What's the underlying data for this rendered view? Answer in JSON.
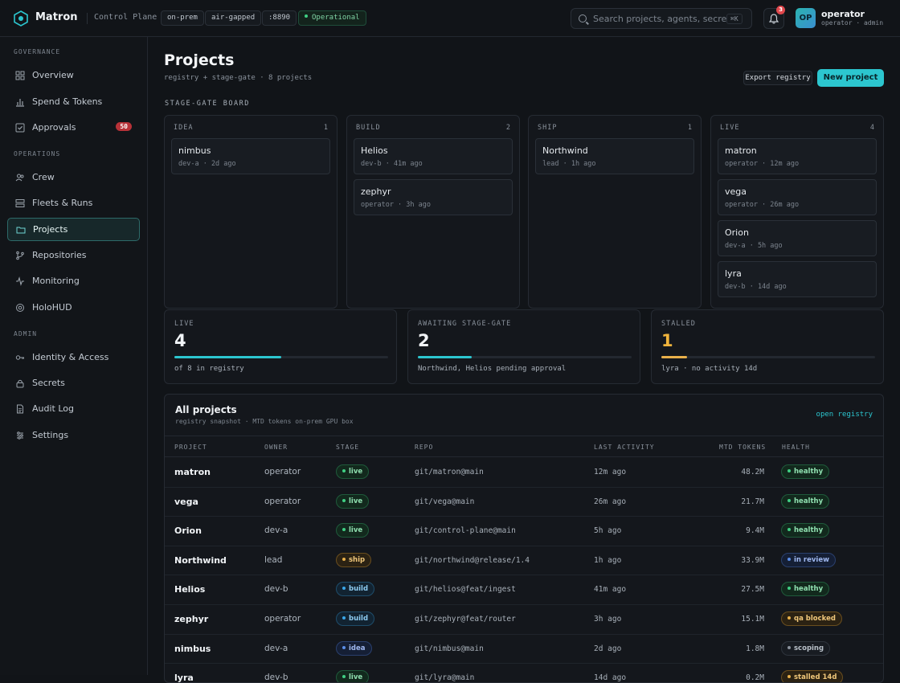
{
  "app": {
    "title": "Matron",
    "subtitle": "Control Plane"
  },
  "env_pills": [
    "on-prem",
    "air-gapped",
    ":8890"
  ],
  "status_pill": "Operational",
  "search": {
    "placeholder": "Search projects, agents, secrets...",
    "shortcut": "⌘K"
  },
  "notifications": {
    "count": "3"
  },
  "user": {
    "initials": "OP",
    "name": "operator",
    "role": "operator · admin"
  },
  "sidebar": {
    "sections": [
      {
        "label": "GOVERNANCE",
        "items": [
          {
            "label": "Overview",
            "icon": "grid-icon"
          },
          {
            "label": "Spend & Tokens",
            "icon": "bar-chart-icon"
          },
          {
            "label": "Approvals",
            "icon": "check-square-icon",
            "badge": "50"
          }
        ]
      },
      {
        "label": "OPERATIONS",
        "items": [
          {
            "label": "Crew",
            "icon": "users-icon"
          },
          {
            "label": "Fleets & Runs",
            "icon": "server-icon"
          },
          {
            "label": "Projects",
            "icon": "folder-icon",
            "active": true
          },
          {
            "label": "Repositories",
            "icon": "git-branch-icon"
          },
          {
            "label": "Monitoring",
            "icon": "activity-icon"
          },
          {
            "label": "HoloHUD",
            "icon": "target-icon"
          }
        ]
      },
      {
        "label": "ADMIN",
        "items": [
          {
            "label": "Identity & Access",
            "icon": "key-icon"
          },
          {
            "label": "Secrets",
            "icon": "lock-icon"
          },
          {
            "label": "Audit Log",
            "icon": "file-text-icon"
          },
          {
            "label": "Settings",
            "icon": "sliders-icon"
          }
        ]
      }
    ]
  },
  "page": {
    "title": "Projects",
    "subtitle": "registry + stage-gate · 8 projects",
    "export_label": "Export registry",
    "new_label": "New project",
    "board_label": "STAGE-GATE BOARD"
  },
  "board": [
    {
      "stage": "IDEA",
      "count": "1",
      "cards": [
        {
          "name": "nimbus",
          "meta": "dev-a · 2d ago"
        }
      ]
    },
    {
      "stage": "BUILD",
      "count": "2",
      "cards": [
        {
          "name": "Helios",
          "meta": "dev-b · 41m ago"
        },
        {
          "name": "zephyr",
          "meta": "operator · 3h ago"
        }
      ]
    },
    {
      "stage": "SHIP",
      "count": "1",
      "cards": [
        {
          "name": "Northwind",
          "meta": "lead · 1h ago"
        }
      ]
    },
    {
      "stage": "LIVE",
      "count": "4",
      "cards": [
        {
          "name": "matron",
          "meta": "operator · 12m ago"
        },
        {
          "name": "vega",
          "meta": "operator · 26m ago"
        },
        {
          "name": "Orion",
          "meta": "dev-a · 5h ago"
        },
        {
          "name": "lyra",
          "meta": "dev-b · 14d ago"
        }
      ]
    }
  ],
  "stats": [
    {
      "label": "LIVE",
      "value": "4",
      "note": "of 8 in registry",
      "progress": 0.5,
      "color": "#2cc6cf",
      "value_color": "#f1f4f7"
    },
    {
      "label": "AWAITING STAGE-GATE",
      "value": "2",
      "note": "Northwind, Helios pending approval",
      "progress": 0.25,
      "color": "#2cc6cf",
      "value_color": "#f1f4f7"
    },
    {
      "label": "STALLED",
      "value": "1",
      "note": "lyra · no activity 14d",
      "progress": 0.12,
      "color": "#e8b04a",
      "value_color": "#f0b43c"
    }
  ],
  "table": {
    "title": "All projects",
    "subtitle": "registry snapshot · MTD tokens on-prem GPU box",
    "link": "open registry",
    "columns": [
      "PROJECT",
      "OWNER",
      "STAGE",
      "REPO",
      "LAST ACTIVITY",
      "MTD TOKENS",
      "HEALTH"
    ],
    "rows": [
      {
        "project": "matron",
        "owner": "operator",
        "stage": "live",
        "repo": "git/matron@main",
        "activity": "12m ago",
        "tokens": "48.2M",
        "health": "healthy"
      },
      {
        "project": "vega",
        "owner": "operator",
        "stage": "live",
        "repo": "git/vega@main",
        "activity": "26m ago",
        "tokens": "21.7M",
        "health": "healthy"
      },
      {
        "project": "Orion",
        "owner": "dev-a",
        "stage": "live",
        "repo": "git/control-plane@main",
        "activity": "5h ago",
        "tokens": "9.4M",
        "health": "healthy"
      },
      {
        "project": "Northwind",
        "owner": "lead",
        "stage": "ship",
        "repo": "git/northwind@release/1.4",
        "activity": "1h ago",
        "tokens": "33.9M",
        "health": "in review"
      },
      {
        "project": "Helios",
        "owner": "dev-b",
        "stage": "build",
        "repo": "git/helios@feat/ingest",
        "activity": "41m ago",
        "tokens": "27.5M",
        "health": "healthy"
      },
      {
        "project": "zephyr",
        "owner": "operator",
        "stage": "build",
        "repo": "git/zephyr@feat/router",
        "activity": "3h ago",
        "tokens": "15.1M",
        "health": "qa blocked"
      },
      {
        "project": "nimbus",
        "owner": "dev-a",
        "stage": "idea",
        "repo": "git/nimbus@main",
        "activity": "2d ago",
        "tokens": "1.8M",
        "health": "scoping"
      },
      {
        "project": "lyra",
        "owner": "dev-b",
        "stage": "live",
        "repo": "git/lyra@main",
        "activity": "14d ago",
        "tokens": "0.2M",
        "health": "stalled 14d"
      }
    ]
  },
  "colors": {
    "accent": "#2cc6cf",
    "live": "#3fcf83",
    "ship": "#e8b04a",
    "build": "#3aa6e8",
    "idea": "#5a8ee8",
    "danger": "#e0474c"
  }
}
